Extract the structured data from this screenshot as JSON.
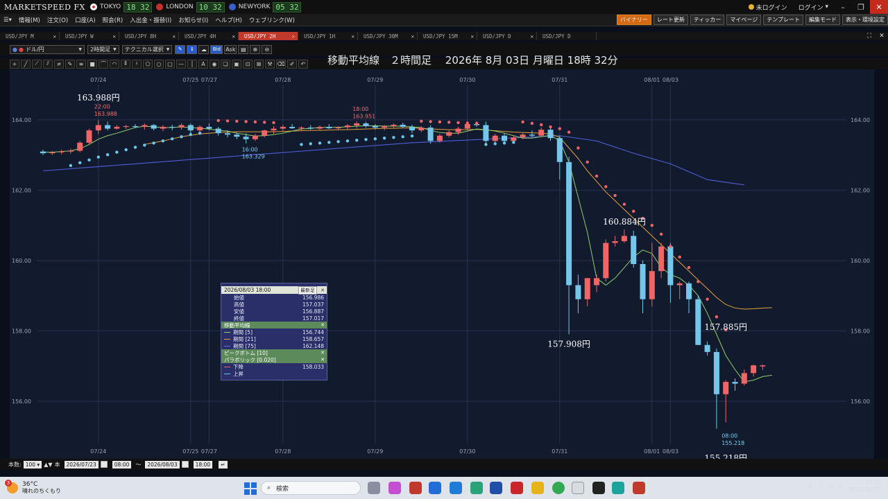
{
  "titlebar": {
    "logo": "MARKETSPEED FX",
    "cities": [
      {
        "name": "TOKYO",
        "time": "18 32",
        "flag_color": "#d9302c"
      },
      {
        "name": "LONDON",
        "time": "10 32",
        "flag_color": "#c9302c"
      },
      {
        "name": "NEWYORK",
        "time": "05 32",
        "flag_color": "#3a5fcd"
      }
    ],
    "not_logged_in": "未ログイン",
    "login": "ログイン"
  },
  "menu": {
    "items": [
      "情報(M)",
      "注文(O)",
      "口座(A)",
      "照会(R)",
      "入出金・振替(I)",
      "お知らせ(I)",
      "ヘルプ(H)",
      "ウェブリンク(W)"
    ],
    "right_buttons": [
      "バイナリー",
      "レート更新",
      "ティッカー",
      "マイページ",
      "テンプレート",
      "編集モード",
      "表示・環境設定"
    ]
  },
  "tabs": [
    {
      "label": "USD/JPY M",
      "active": false
    },
    {
      "label": "USD/JPY W",
      "active": false
    },
    {
      "label": "USD/JPY 8H",
      "active": false
    },
    {
      "label": "USD/JPY 4H",
      "active": false
    },
    {
      "label": "USD/JPY 2H",
      "active": true
    },
    {
      "label": "USD/JPY 1H",
      "active": false
    },
    {
      "label": "USD/JPY 30M",
      "active": false
    },
    {
      "label": "USD/JPY 15M",
      "active": false
    },
    {
      "label": "USD/JPY D",
      "active": false
    },
    {
      "label": "USD/JPY D",
      "active": false
    }
  ],
  "toolbar": {
    "currency": "ドル/円",
    "interval": "2時間足",
    "technical": "テクニカル選択",
    "bid": "Bid",
    "ask": "Ask"
  },
  "chart_title": "移動平均線　２時間足　 2026年 8月 03日 月曜日 18時 32分",
  "info_panel": {
    "datetime": "2026/08/03 18:00",
    "latest_btn": "最新足",
    "ohlc": [
      {
        "label": "始値",
        "value": "156.986"
      },
      {
        "label": "高値",
        "value": "157.037"
      },
      {
        "label": "安値",
        "value": "156.887"
      },
      {
        "label": "終値",
        "value": "157.017"
      }
    ],
    "ma_title": "移動平均線",
    "ma": [
      {
        "label": "期間 [5]",
        "value": "156.744",
        "color": "#8fd16a"
      },
      {
        "label": "期間 [21]",
        "value": "158.657",
        "color": "#e8a13a"
      },
      {
        "label": "期間 [75]",
        "value": "162.148",
        "color": "#5a6cf0"
      }
    ],
    "peak_bottom": "ピークボトム [10]",
    "parabolic": "パラボリック [0.020]",
    "sar_down_label": "下降",
    "sar_down_value": "158.033",
    "sar_up_label": "上昇"
  },
  "bottombar": {
    "count_label": "本数:",
    "count": "100",
    "unit": "本",
    "start_date": "2026/07/23",
    "start_time": "08:00",
    "tilde": "〜",
    "end_date": "2026/08/03",
    "end_time": "18:00"
  },
  "taskbar": {
    "temp": "36°C",
    "weather": "晴れのちくもり",
    "badge": "3",
    "search": "検索",
    "time": "18:32",
    "date": "2026/08/03"
  },
  "chart_data": {
    "type": "candlestick",
    "ylim": [
      154.6,
      165.2
    ],
    "yticks": [
      156,
      158,
      160,
      162,
      164
    ],
    "ytick_labels": [
      "156.00",
      "158.00",
      "160.00",
      "162.00",
      "164.00"
    ],
    "date_labels": [
      {
        "label": "07/24",
        "i": 6
      },
      {
        "label": "07/25",
        "i": 16
      },
      {
        "label": "07/27",
        "i": 18
      },
      {
        "label": "07/28",
        "i": 26
      },
      {
        "label": "07/29",
        "i": 36
      },
      {
        "label": "07/30",
        "i": 46
      },
      {
        "label": "07/31",
        "i": 56
      },
      {
        "label": "08/01",
        "i": 66
      },
      {
        "label": "08/03",
        "i": 68
      }
    ],
    "candles": [
      [
        163.1,
        163.15,
        163.0,
        163.05
      ],
      [
        163.05,
        163.12,
        163.0,
        163.08
      ],
      [
        163.08,
        163.15,
        163.02,
        163.1
      ],
      [
        163.1,
        163.18,
        163.04,
        163.12
      ],
      [
        163.12,
        163.4,
        163.08,
        163.35
      ],
      [
        163.35,
        163.75,
        163.3,
        163.7
      ],
      [
        163.7,
        163.99,
        163.6,
        163.85
      ],
      [
        163.85,
        163.95,
        163.7,
        163.75
      ],
      [
        163.75,
        163.85,
        163.72,
        163.8
      ],
      [
        163.8,
        163.86,
        163.74,
        163.82
      ],
      [
        163.82,
        163.88,
        163.76,
        163.8
      ],
      [
        163.8,
        163.9,
        163.72,
        163.85
      ],
      [
        163.85,
        163.88,
        163.7,
        163.75
      ],
      [
        163.75,
        163.85,
        163.68,
        163.8
      ],
      [
        163.8,
        163.86,
        163.7,
        163.78
      ],
      [
        163.78,
        163.9,
        163.72,
        163.85
      ],
      [
        163.85,
        163.9,
        163.62,
        163.7
      ],
      [
        163.7,
        163.85,
        163.65,
        163.8
      ],
      [
        163.8,
        163.9,
        163.7,
        163.75
      ],
      [
        163.75,
        163.8,
        163.55,
        163.62
      ],
      [
        163.62,
        163.7,
        163.5,
        163.58
      ],
      [
        163.58,
        163.64,
        163.45,
        163.52
      ],
      [
        163.52,
        163.62,
        163.33,
        163.45
      ],
      [
        163.45,
        163.6,
        163.4,
        163.55
      ],
      [
        163.55,
        163.72,
        163.5,
        163.7
      ],
      [
        163.7,
        163.82,
        163.6,
        163.75
      ],
      [
        163.75,
        163.85,
        163.68,
        163.8
      ],
      [
        163.8,
        163.88,
        163.74,
        163.76
      ],
      [
        163.76,
        163.82,
        163.7,
        163.78
      ],
      [
        163.78,
        163.85,
        163.72,
        163.75
      ],
      [
        163.75,
        163.84,
        163.7,
        163.8
      ],
      [
        163.8,
        163.88,
        163.74,
        163.76
      ],
      [
        163.76,
        163.82,
        163.7,
        163.79
      ],
      [
        163.79,
        163.88,
        163.72,
        163.84
      ],
      [
        163.84,
        163.95,
        163.75,
        163.9
      ],
      [
        163.9,
        163.95,
        163.78,
        163.82
      ],
      [
        163.82,
        163.88,
        163.72,
        163.78
      ],
      [
        163.78,
        163.85,
        163.7,
        163.82
      ],
      [
        163.82,
        163.9,
        163.76,
        163.86
      ],
      [
        163.86,
        163.92,
        163.78,
        163.8
      ],
      [
        163.8,
        163.86,
        163.62,
        163.7
      ],
      [
        163.7,
        163.82,
        163.65,
        163.78
      ],
      [
        163.78,
        163.85,
        163.32,
        163.4
      ],
      [
        163.4,
        163.6,
        163.35,
        163.55
      ],
      [
        163.55,
        163.7,
        163.5,
        163.65
      ],
      [
        163.65,
        163.8,
        163.58,
        163.75
      ],
      [
        163.75,
        163.95,
        163.7,
        163.88
      ],
      [
        163.88,
        163.96,
        163.8,
        163.85
      ],
      [
        163.85,
        163.95,
        163.3,
        163.4
      ],
      [
        163.4,
        163.6,
        163.3,
        163.55
      ],
      [
        163.55,
        163.62,
        163.3,
        163.4
      ],
      [
        163.4,
        163.55,
        163.32,
        163.5
      ],
      [
        163.5,
        163.62,
        163.45,
        163.58
      ],
      [
        163.58,
        163.7,
        163.5,
        163.55
      ],
      [
        163.55,
        163.78,
        163.5,
        163.72
      ],
      [
        163.72,
        163.8,
        163.4,
        163.48
      ],
      [
        163.48,
        163.55,
        162.3,
        162.8
      ],
      [
        162.8,
        162.95,
        157.9,
        159.3
      ],
      [
        159.3,
        159.6,
        158.5,
        158.9
      ],
      [
        158.9,
        159.5,
        158.7,
        159.5
      ],
      [
        159.3,
        159.6,
        159.1,
        159.5
      ],
      [
        159.5,
        160.6,
        159.4,
        160.5
      ],
      [
        160.5,
        160.7,
        160.4,
        160.55
      ],
      [
        160.55,
        160.88,
        160.5,
        160.7
      ],
      [
        160.7,
        160.85,
        159.8,
        159.9
      ],
      [
        159.9,
        160.0,
        158.5,
        158.9
      ],
      [
        158.9,
        160.5,
        158.7,
        159.7
      ],
      [
        159.7,
        160.5,
        159.5,
        160.4
      ],
      [
        160.4,
        160.5,
        158.8,
        159.3
      ],
      [
        159.3,
        159.4,
        158.9,
        159.35
      ],
      [
        159.35,
        159.4,
        158.5,
        158.9
      ],
      [
        158.9,
        159.0,
        157.6,
        157.6
      ],
      [
        157.6,
        157.7,
        157.3,
        157.4
      ],
      [
        157.4,
        157.5,
        155.22,
        156.2
      ],
      [
        156.2,
        156.6,
        155.4,
        156.55
      ],
      [
        156.55,
        156.65,
        156.3,
        156.5
      ],
      [
        156.5,
        156.9,
        156.45,
        156.8
      ],
      [
        156.8,
        157.04,
        156.7,
        157.02
      ],
      [
        156.99,
        157.04,
        156.89,
        157.02
      ]
    ],
    "ma5": [
      163.08,
      163.08,
      163.1,
      163.12,
      163.18,
      163.3,
      163.45,
      163.55,
      163.62,
      163.7,
      163.78,
      163.82,
      163.8,
      163.78,
      163.78,
      163.8,
      163.78,
      163.76,
      163.74,
      163.7,
      163.68,
      163.62,
      163.58,
      163.54,
      163.55,
      163.58,
      163.62,
      163.68,
      163.74,
      163.76,
      163.78,
      163.79,
      163.79,
      163.8,
      163.82,
      163.83,
      163.83,
      163.82,
      163.82,
      163.82,
      163.8,
      163.78,
      163.7,
      163.64,
      163.62,
      163.62,
      163.68,
      163.74,
      163.72,
      163.68,
      163.62,
      163.55,
      163.48,
      163.48,
      163.52,
      163.56,
      163.4,
      162.8,
      161.8,
      160.8,
      159.5,
      159.3,
      159.5,
      159.8,
      160.1,
      160.3,
      160.2,
      159.8,
      159.6,
      159.5,
      159.3,
      159.0,
      158.5,
      157.9,
      157.3,
      156.9,
      156.55,
      156.6,
      156.7,
      156.74
    ],
    "ma21": [
      null,
      null,
      null,
      null,
      null,
      null,
      null,
      null,
      null,
      null,
      null,
      163.3,
      163.35,
      163.4,
      163.46,
      163.52,
      163.56,
      163.6,
      163.62,
      163.64,
      163.65,
      163.66,
      163.66,
      163.66,
      163.66,
      163.66,
      163.67,
      163.68,
      163.69,
      163.7,
      163.7,
      163.71,
      163.72,
      163.72,
      163.73,
      163.74,
      163.75,
      163.76,
      163.76,
      163.77,
      163.77,
      163.76,
      163.74,
      163.73,
      163.72,
      163.72,
      163.72,
      163.73,
      163.71,
      163.69,
      163.67,
      163.65,
      163.64,
      163.63,
      163.62,
      163.6,
      163.5,
      163.2,
      162.9,
      162.55,
      162.25,
      161.95,
      161.7,
      161.45,
      161.2,
      160.95,
      160.7,
      160.45,
      160.2,
      159.95,
      159.7,
      159.45,
      159.2,
      158.95,
      158.75,
      158.65,
      158.62,
      158.63,
      158.65,
      158.66
    ],
    "ma75_visible": [
      [
        0,
        162.55
      ],
      [
        20,
        162.95
      ],
      [
        40,
        163.35
      ],
      [
        56,
        163.55
      ],
      [
        60,
        163.4
      ],
      [
        64,
        163.05
      ],
      [
        68,
        162.75
      ],
      [
        72,
        162.3
      ],
      [
        76,
        162.15
      ]
    ],
    "sar": [
      [
        3,
        162.7
      ],
      [
        4,
        162.78
      ],
      [
        5,
        162.86
      ],
      [
        6,
        162.94
      ],
      [
        7,
        163.01
      ],
      [
        8,
        163.08
      ],
      [
        9,
        163.15
      ],
      [
        10,
        163.22
      ],
      [
        11,
        163.28
      ],
      [
        12,
        163.34
      ],
      [
        13,
        163.4
      ],
      [
        14,
        163.46
      ],
      [
        15,
        163.52
      ],
      [
        16,
        163.58
      ],
      [
        17,
        163.62
      ],
      [
        19,
        163.98
      ],
      [
        20,
        163.97
      ],
      [
        21,
        163.96
      ],
      [
        22,
        163.95
      ],
      [
        23,
        163.94
      ],
      [
        24,
        163.93
      ],
      [
        25,
        163.92
      ],
      [
        28,
        163.3
      ],
      [
        29,
        163.32
      ],
      [
        30,
        163.34
      ],
      [
        31,
        163.36
      ],
      [
        32,
        163.38
      ],
      [
        33,
        163.4
      ],
      [
        34,
        163.42
      ],
      [
        35,
        163.44
      ],
      [
        36,
        163.46
      ],
      [
        37,
        163.48
      ],
      [
        38,
        163.5
      ],
      [
        39,
        163.52
      ],
      [
        40,
        163.54
      ],
      [
        41,
        163.96
      ],
      [
        42,
        163.95
      ],
      [
        43,
        163.94
      ],
      [
        44,
        163.93
      ],
      [
        45,
        163.92
      ],
      [
        46,
        163.91
      ],
      [
        47,
        163.9
      ],
      [
        48,
        163.3
      ],
      [
        49,
        163.32
      ],
      [
        50,
        163.34
      ],
      [
        51,
        163.36
      ],
      [
        52,
        163.94
      ],
      [
        53,
        163.9
      ],
      [
        54,
        163.86
      ],
      [
        55,
        163.8
      ],
      [
        56,
        163.75
      ],
      [
        57,
        163.65
      ],
      [
        58,
        163.2
      ],
      [
        59,
        162.8
      ],
      [
        60,
        162.4
      ],
      [
        61,
        162.1
      ],
      [
        62,
        161.85
      ],
      [
        63,
        161.6
      ],
      [
        64,
        161.4
      ],
      [
        65,
        161.2
      ],
      [
        66,
        161.0
      ],
      [
        67,
        160.75
      ],
      [
        68,
        160.4
      ],
      [
        69,
        160.1
      ],
      [
        70,
        159.8
      ],
      [
        71,
        159.4
      ],
      [
        72,
        158.9
      ],
      [
        73,
        158.4
      ],
      [
        74,
        158.03
      ]
    ],
    "annotations": [
      {
        "text": "163.988円",
        "i": 6,
        "y": 164.55,
        "kind": "big"
      },
      {
        "text": "22:00",
        "i": 6,
        "y": 164.32,
        "kind": "small_red"
      },
      {
        "text": "163.988",
        "i": 6,
        "y": 164.12,
        "kind": "small_red"
      },
      {
        "text": "18:00",
        "i": 34,
        "y": 164.25,
        "kind": "small_red"
      },
      {
        "text": "163.951",
        "i": 34,
        "y": 164.05,
        "kind": "small_red"
      },
      {
        "text": "16:00",
        "i": 22,
        "y": 163.1,
        "kind": "small_blue"
      },
      {
        "text": "163.329",
        "i": 22,
        "y": 162.9,
        "kind": "small_blue"
      },
      {
        "text": "160.884円",
        "i": 63,
        "y": 161.02,
        "kind": "big"
      },
      {
        "text": "157.908円",
        "i": 57,
        "y": 157.55,
        "kind": "big"
      },
      {
        "text": "157.885円",
        "i": 74,
        "y": 158.03,
        "kind": "big"
      },
      {
        "text": "08:00",
        "i": 74,
        "y": 154.96,
        "kind": "small_blue"
      },
      {
        "text": "155.218",
        "i": 74,
        "y": 154.76,
        "kind": "small_blue"
      },
      {
        "text": "155.218円",
        "i": 74,
        "y": 154.3,
        "kind": "big"
      }
    ],
    "colors": {
      "up": "#f06666",
      "down": "#74c6ea",
      "ma5": "#8fd16a",
      "ma21": "#e8a13a",
      "ma75": "#4f5fd8",
      "sar_down": "#f06666",
      "sar_up": "#6cc8ee",
      "grid": "#2a3350",
      "text": "#9aa3bb"
    }
  }
}
